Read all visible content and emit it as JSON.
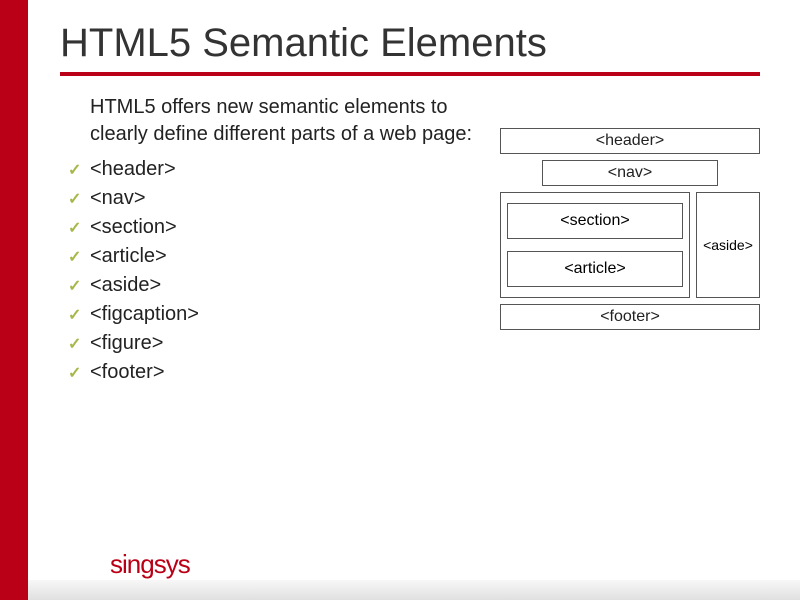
{
  "title": "HTML5 Semantic Elements",
  "intro": "HTML5 offers new semantic elements to clearly define different parts of a web page:",
  "bullets": [
    "<header>",
    "<nav>",
    "<section>",
    "<article>",
    "<aside>",
    "<figcaption>",
    "<figure>",
    "<footer>"
  ],
  "diagram": {
    "header": "<header>",
    "nav": "<nav>",
    "section": "<section>",
    "article": "<article>",
    "aside": "<aside>",
    "footer": "<footer>"
  },
  "brand": "singsys"
}
